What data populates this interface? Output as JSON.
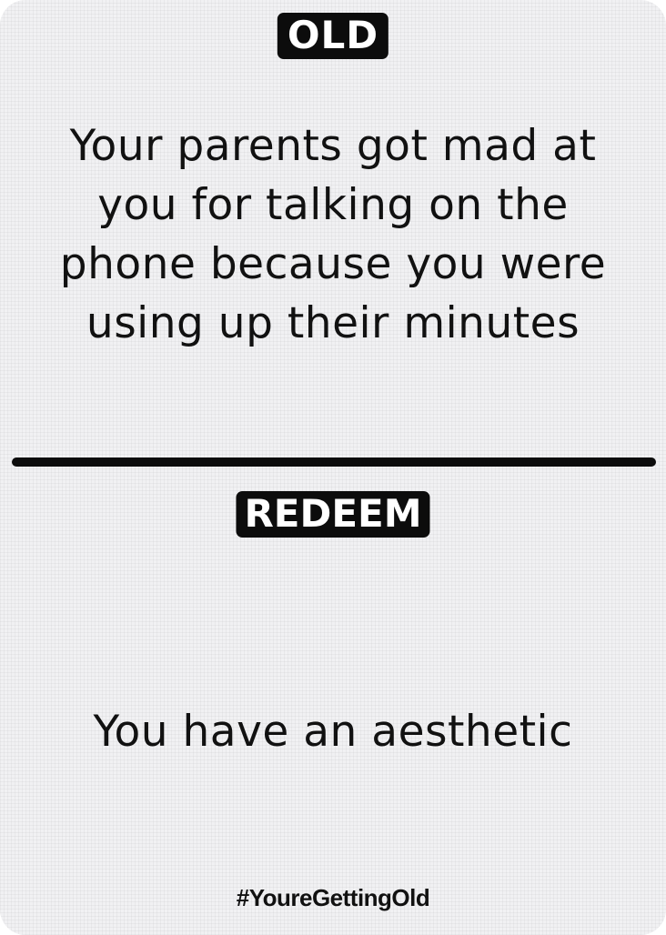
{
  "card": {
    "top_label": "OLD",
    "old_statement": "Your parents got mad at you for talking on the phone because you were using up their minutes",
    "bottom_label": "REDEEM",
    "redeem_statement": "You have an aesthetic",
    "hashtag": "#YoureGettingOld"
  },
  "colors": {
    "card_background": "#f1f1f3",
    "ink": "#111111",
    "badge_background": "#0c0c0c",
    "badge_text": "#ffffff"
  }
}
